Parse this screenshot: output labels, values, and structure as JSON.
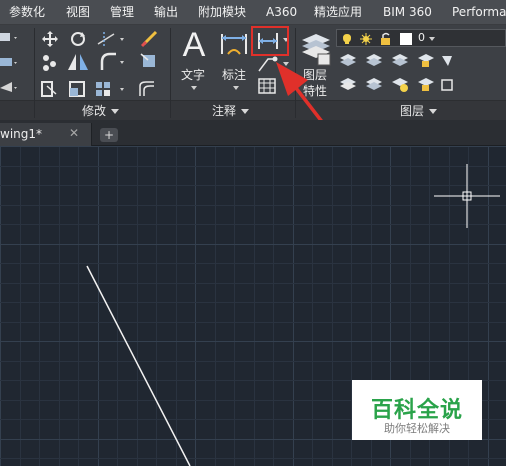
{
  "menu": {
    "tabs": [
      {
        "label": "参数化"
      },
      {
        "label": "视图"
      },
      {
        "label": "管理"
      },
      {
        "label": "输出"
      },
      {
        "label": "附加模块"
      },
      {
        "label": "A360"
      },
      {
        "label": "精选应用"
      },
      {
        "label": "BIM 360"
      },
      {
        "label": "Performa"
      }
    ]
  },
  "ribbon": {
    "modify_panel": {
      "label": "修改"
    },
    "annotation_panel": {
      "label": "注释",
      "text_label": "文字",
      "dimension_label": "标注"
    },
    "layers_panel": {
      "label": "图层",
      "layer_props_label_line1": "图层",
      "layer_props_label_line2": "特性",
      "current_layer": "0"
    }
  },
  "file_tabs": {
    "active": {
      "name": "wing1*",
      "close": "✕"
    },
    "new_tab": "+"
  },
  "watermark": {
    "title": "百科全说",
    "subtitle": "助你轻松解决"
  },
  "colors": {
    "ribbon_bg": "#3d4045",
    "canvas_bg": "#202731",
    "highlight": "#e0302a",
    "watermark_green": "#2aa34a"
  }
}
